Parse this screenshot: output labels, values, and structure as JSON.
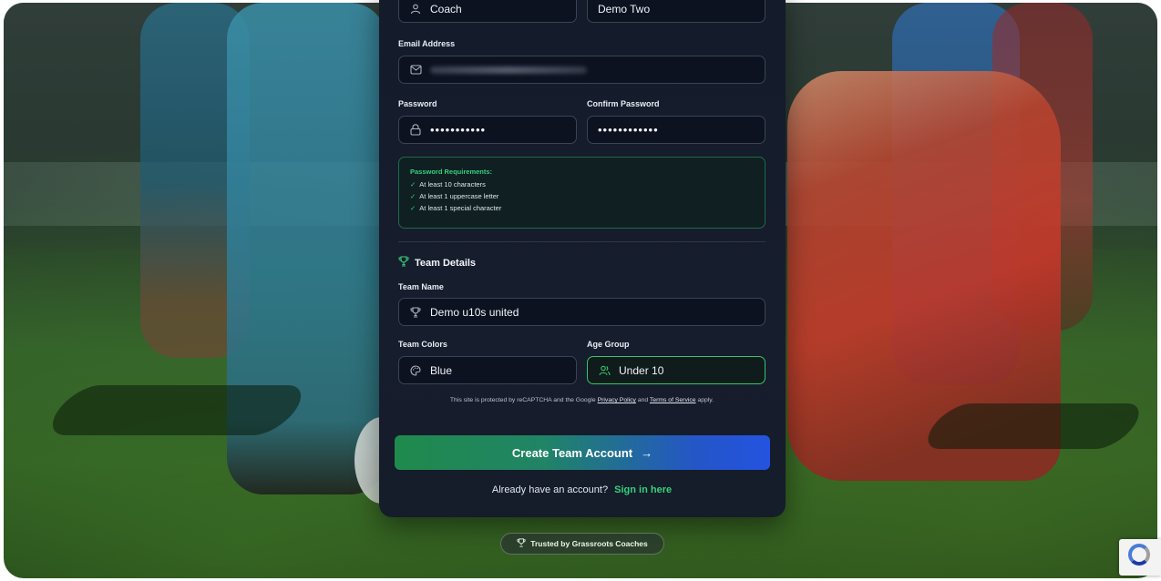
{
  "form": {
    "role_value": "Coach",
    "last_name_value": "Demo Two",
    "email_label": "Email Address",
    "password_label": "Password",
    "confirm_password_label": "Confirm Password",
    "password_mask": "•••••••••••",
    "confirm_password_mask": "••••••••••••",
    "requirements": {
      "title": "Password Requirements:",
      "check_glyph": "✓",
      "items": [
        "At least 10 characters",
        "At least 1 uppercase letter",
        "At least 1 special character"
      ]
    },
    "team_section_title": "Team Details",
    "team_name_label": "Team Name",
    "team_name_value": "Demo u10s united",
    "team_colors_label": "Team Colors",
    "team_colors_value": "Blue",
    "age_group_label": "Age Group",
    "age_group_value": "Under 10",
    "recaptcha_text_1": "This site is protected by reCAPTCHA and the Google",
    "privacy_policy": "Privacy Policy",
    "recaptcha_and": "and",
    "terms_of_service": "Terms of Service",
    "recaptcha_text_2": "apply.",
    "submit_label": "Create Team Account",
    "submit_arrow": "→",
    "signin_prompt": "Already have an account?",
    "signin_link": "Sign in here"
  },
  "footer": {
    "trusted_label": "Trusted by Grassroots Coaches"
  },
  "icons": {
    "user": "user-icon",
    "mail": "mail-icon",
    "lock": "lock-icon",
    "trophy": "trophy-icon",
    "palette": "palette-icon",
    "users": "users-icon"
  },
  "colors": {
    "accent_green": "#35d27a",
    "cta_start": "#1f8a4c",
    "cta_end": "#2453e0",
    "card_bg": "#141b2b"
  }
}
